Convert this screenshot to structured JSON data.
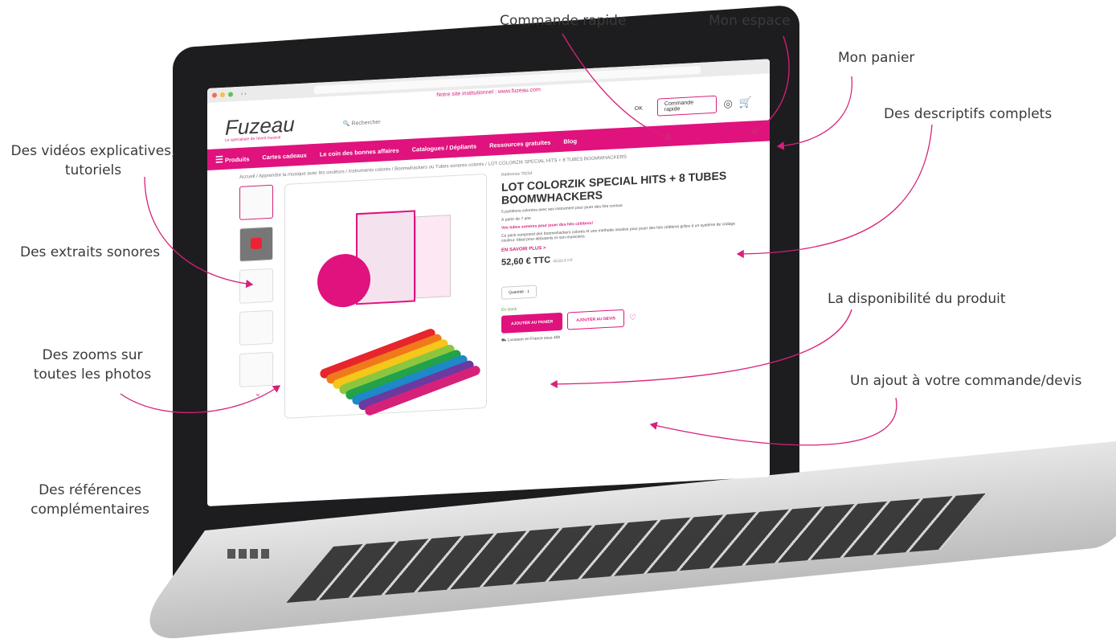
{
  "callouts": {
    "commande_rapide": "Commande rapide",
    "mon_espace": "Mon espace",
    "mon_panier": "Mon panier",
    "descriptifs": "Des descriptifs complets",
    "videos_line1": "Des vidéos explicatives,",
    "videos_line2": "tutoriels",
    "extraits": "Des extraits sonores",
    "zooms_line1": "Des zooms sur",
    "zooms_line2": "toutes les photos",
    "references_line1": "Des références",
    "references_line2": "complémentaires",
    "disponibilite": "La disponibilité du produit",
    "ajout": "Un ajout à votre commande/devis"
  },
  "site": {
    "notice": "Notre site institutionnel : www.fuzeau.com",
    "logo": "Fuzeau",
    "logo_sub": "Le spécialiste de l'éveil musical",
    "search_placeholder": "Rechercher",
    "search_ok": "OK",
    "quick_order": "Commande rapide",
    "account_icon": "user-icon",
    "cart_icon": "cart-icon",
    "menu": {
      "products": "Produits",
      "items": [
        "Cartes cadeaux",
        "Le coin des bonnes affaires",
        "Catalogues / Dépliants",
        "Ressources gratuites",
        "Blog"
      ]
    },
    "breadcrumb": "Accueil / Apprendre la musique avec les couleurs / Instruments colorés / Boomwhackers ou Tubes sonores colorés / LOT COLORZIK SPECIAL HITS + 8 TUBES BOOMWHACKERS"
  },
  "product": {
    "reference": "Référence 78234",
    "title": "LOT COLORZIK SPECIAL HITS + 8 TUBES BOOMWHACKERS",
    "subtitle": "5 partitions colorées avec ses instrument pour jouer des hits connus",
    "age": "À partir de 7 ans",
    "highlight": "Vos tubes sonores pour jouer des hits célèbres!",
    "description": "Ce pack comprend des boomwhackers colorés et une méthode intuitive pour jouer des hits célèbres grâce à un système de codage couleur. Idéal pour débutants et non-musiciens.",
    "more": "EN SAVOIR PLUS >",
    "price": "52,60 € TTC",
    "price_ht": "43,83 € HT",
    "quantity_label": "Quantité : 1",
    "stock": "En stock",
    "add_cart": "AJOUTER AU PANIER",
    "add_quote": "AJOUTER AU DEVIS",
    "shipping": "Livraison en France sous 48h",
    "tube_colors": [
      "#e6262c",
      "#f07a1b",
      "#f4c71a",
      "#8cc63f",
      "#22a24a",
      "#1e88c9",
      "#6a3aa0",
      "#d6217a"
    ]
  }
}
